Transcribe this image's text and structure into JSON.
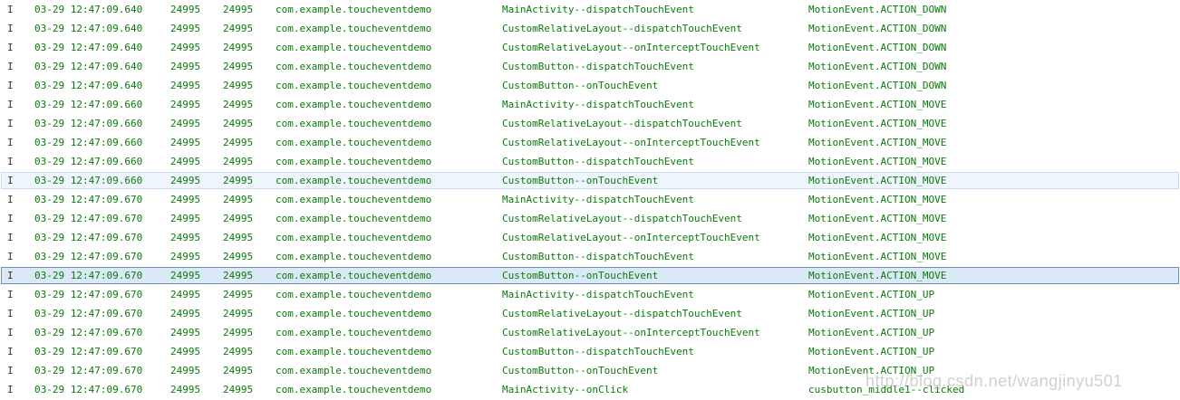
{
  "theme": {
    "text_color": "#0a7a0a",
    "hover_row_background": "#eef5fd",
    "selected_row_background": "#dbe9f7"
  },
  "rows": [
    {
      "level": "I",
      "time": "03-29 12:47:09.640",
      "pid": "24995",
      "tid": "24995",
      "app": "com.example.toucheventdemo",
      "tag": "MainActivity--dispatchTouchEvent",
      "text": "MotionEvent.ACTION_DOWN",
      "state": "normal"
    },
    {
      "level": "I",
      "time": "03-29 12:47:09.640",
      "pid": "24995",
      "tid": "24995",
      "app": "com.example.toucheventdemo",
      "tag": "CustomRelativeLayout--dispatchTouchEvent",
      "text": "MotionEvent.ACTION_DOWN",
      "state": "normal"
    },
    {
      "level": "I",
      "time": "03-29 12:47:09.640",
      "pid": "24995",
      "tid": "24995",
      "app": "com.example.toucheventdemo",
      "tag": "CustomRelativeLayout--onInterceptTouchEvent",
      "text": "MotionEvent.ACTION_DOWN",
      "state": "normal"
    },
    {
      "level": "I",
      "time": "03-29 12:47:09.640",
      "pid": "24995",
      "tid": "24995",
      "app": "com.example.toucheventdemo",
      "tag": "CustomButton--dispatchTouchEvent",
      "text": "MotionEvent.ACTION_DOWN",
      "state": "normal"
    },
    {
      "level": "I",
      "time": "03-29 12:47:09.640",
      "pid": "24995",
      "tid": "24995",
      "app": "com.example.toucheventdemo",
      "tag": "CustomButton--onTouchEvent",
      "text": "MotionEvent.ACTION_DOWN",
      "state": "normal"
    },
    {
      "level": "I",
      "time": "03-29 12:47:09.660",
      "pid": "24995",
      "tid": "24995",
      "app": "com.example.toucheventdemo",
      "tag": "MainActivity--dispatchTouchEvent",
      "text": "MotionEvent.ACTION_MOVE",
      "state": "normal"
    },
    {
      "level": "I",
      "time": "03-29 12:47:09.660",
      "pid": "24995",
      "tid": "24995",
      "app": "com.example.toucheventdemo",
      "tag": "CustomRelativeLayout--dispatchTouchEvent",
      "text": "MotionEvent.ACTION_MOVE",
      "state": "normal"
    },
    {
      "level": "I",
      "time": "03-29 12:47:09.660",
      "pid": "24995",
      "tid": "24995",
      "app": "com.example.toucheventdemo",
      "tag": "CustomRelativeLayout--onInterceptTouchEvent",
      "text": "MotionEvent.ACTION_MOVE",
      "state": "normal"
    },
    {
      "level": "I",
      "time": "03-29 12:47:09.660",
      "pid": "24995",
      "tid": "24995",
      "app": "com.example.toucheventdemo",
      "tag": "CustomButton--dispatchTouchEvent",
      "text": "MotionEvent.ACTION_MOVE",
      "state": "normal"
    },
    {
      "level": "I",
      "time": "03-29 12:47:09.660",
      "pid": "24995",
      "tid": "24995",
      "app": "com.example.toucheventdemo",
      "tag": "CustomButton--onTouchEvent",
      "text": "MotionEvent.ACTION_MOVE",
      "state": "hover"
    },
    {
      "level": "I",
      "time": "03-29 12:47:09.670",
      "pid": "24995",
      "tid": "24995",
      "app": "com.example.toucheventdemo",
      "tag": "MainActivity--dispatchTouchEvent",
      "text": "MotionEvent.ACTION_MOVE",
      "state": "normal"
    },
    {
      "level": "I",
      "time": "03-29 12:47:09.670",
      "pid": "24995",
      "tid": "24995",
      "app": "com.example.toucheventdemo",
      "tag": "CustomRelativeLayout--dispatchTouchEvent",
      "text": "MotionEvent.ACTION_MOVE",
      "state": "normal"
    },
    {
      "level": "I",
      "time": "03-29 12:47:09.670",
      "pid": "24995",
      "tid": "24995",
      "app": "com.example.toucheventdemo",
      "tag": "CustomRelativeLayout--onInterceptTouchEvent",
      "text": "MotionEvent.ACTION_MOVE",
      "state": "normal"
    },
    {
      "level": "I",
      "time": "03-29 12:47:09.670",
      "pid": "24995",
      "tid": "24995",
      "app": "com.example.toucheventdemo",
      "tag": "CustomButton--dispatchTouchEvent",
      "text": "MotionEvent.ACTION_MOVE",
      "state": "normal"
    },
    {
      "level": "I",
      "time": "03-29 12:47:09.670",
      "pid": "24995",
      "tid": "24995",
      "app": "com.example.toucheventdemo",
      "tag": "CustomButton--onTouchEvent",
      "text": "MotionEvent.ACTION_MOVE",
      "state": "selected"
    },
    {
      "level": "I",
      "time": "03-29 12:47:09.670",
      "pid": "24995",
      "tid": "24995",
      "app": "com.example.toucheventdemo",
      "tag": "MainActivity--dispatchTouchEvent",
      "text": "MotionEvent.ACTION_UP",
      "state": "normal"
    },
    {
      "level": "I",
      "time": "03-29 12:47:09.670",
      "pid": "24995",
      "tid": "24995",
      "app": "com.example.toucheventdemo",
      "tag": "CustomRelativeLayout--dispatchTouchEvent",
      "text": "MotionEvent.ACTION_UP",
      "state": "normal"
    },
    {
      "level": "I",
      "time": "03-29 12:47:09.670",
      "pid": "24995",
      "tid": "24995",
      "app": "com.example.toucheventdemo",
      "tag": "CustomRelativeLayout--onInterceptTouchEvent",
      "text": "MotionEvent.ACTION_UP",
      "state": "normal"
    },
    {
      "level": "I",
      "time": "03-29 12:47:09.670",
      "pid": "24995",
      "tid": "24995",
      "app": "com.example.toucheventdemo",
      "tag": "CustomButton--dispatchTouchEvent",
      "text": "MotionEvent.ACTION_UP",
      "state": "normal"
    },
    {
      "level": "I",
      "time": "03-29 12:47:09.670",
      "pid": "24995",
      "tid": "24995",
      "app": "com.example.toucheventdemo",
      "tag": "CustomButton--onTouchEvent",
      "text": "MotionEvent.ACTION_UP",
      "state": "normal"
    },
    {
      "level": "I",
      "time": "03-29 12:47:09.670",
      "pid": "24995",
      "tid": "24995",
      "app": "com.example.toucheventdemo",
      "tag": "MainActivity--onClick",
      "text": "cusbutton_middle1--clicked",
      "state": "normal"
    }
  ],
  "watermark": "http://blog.csdn.net/wangjinyu501"
}
